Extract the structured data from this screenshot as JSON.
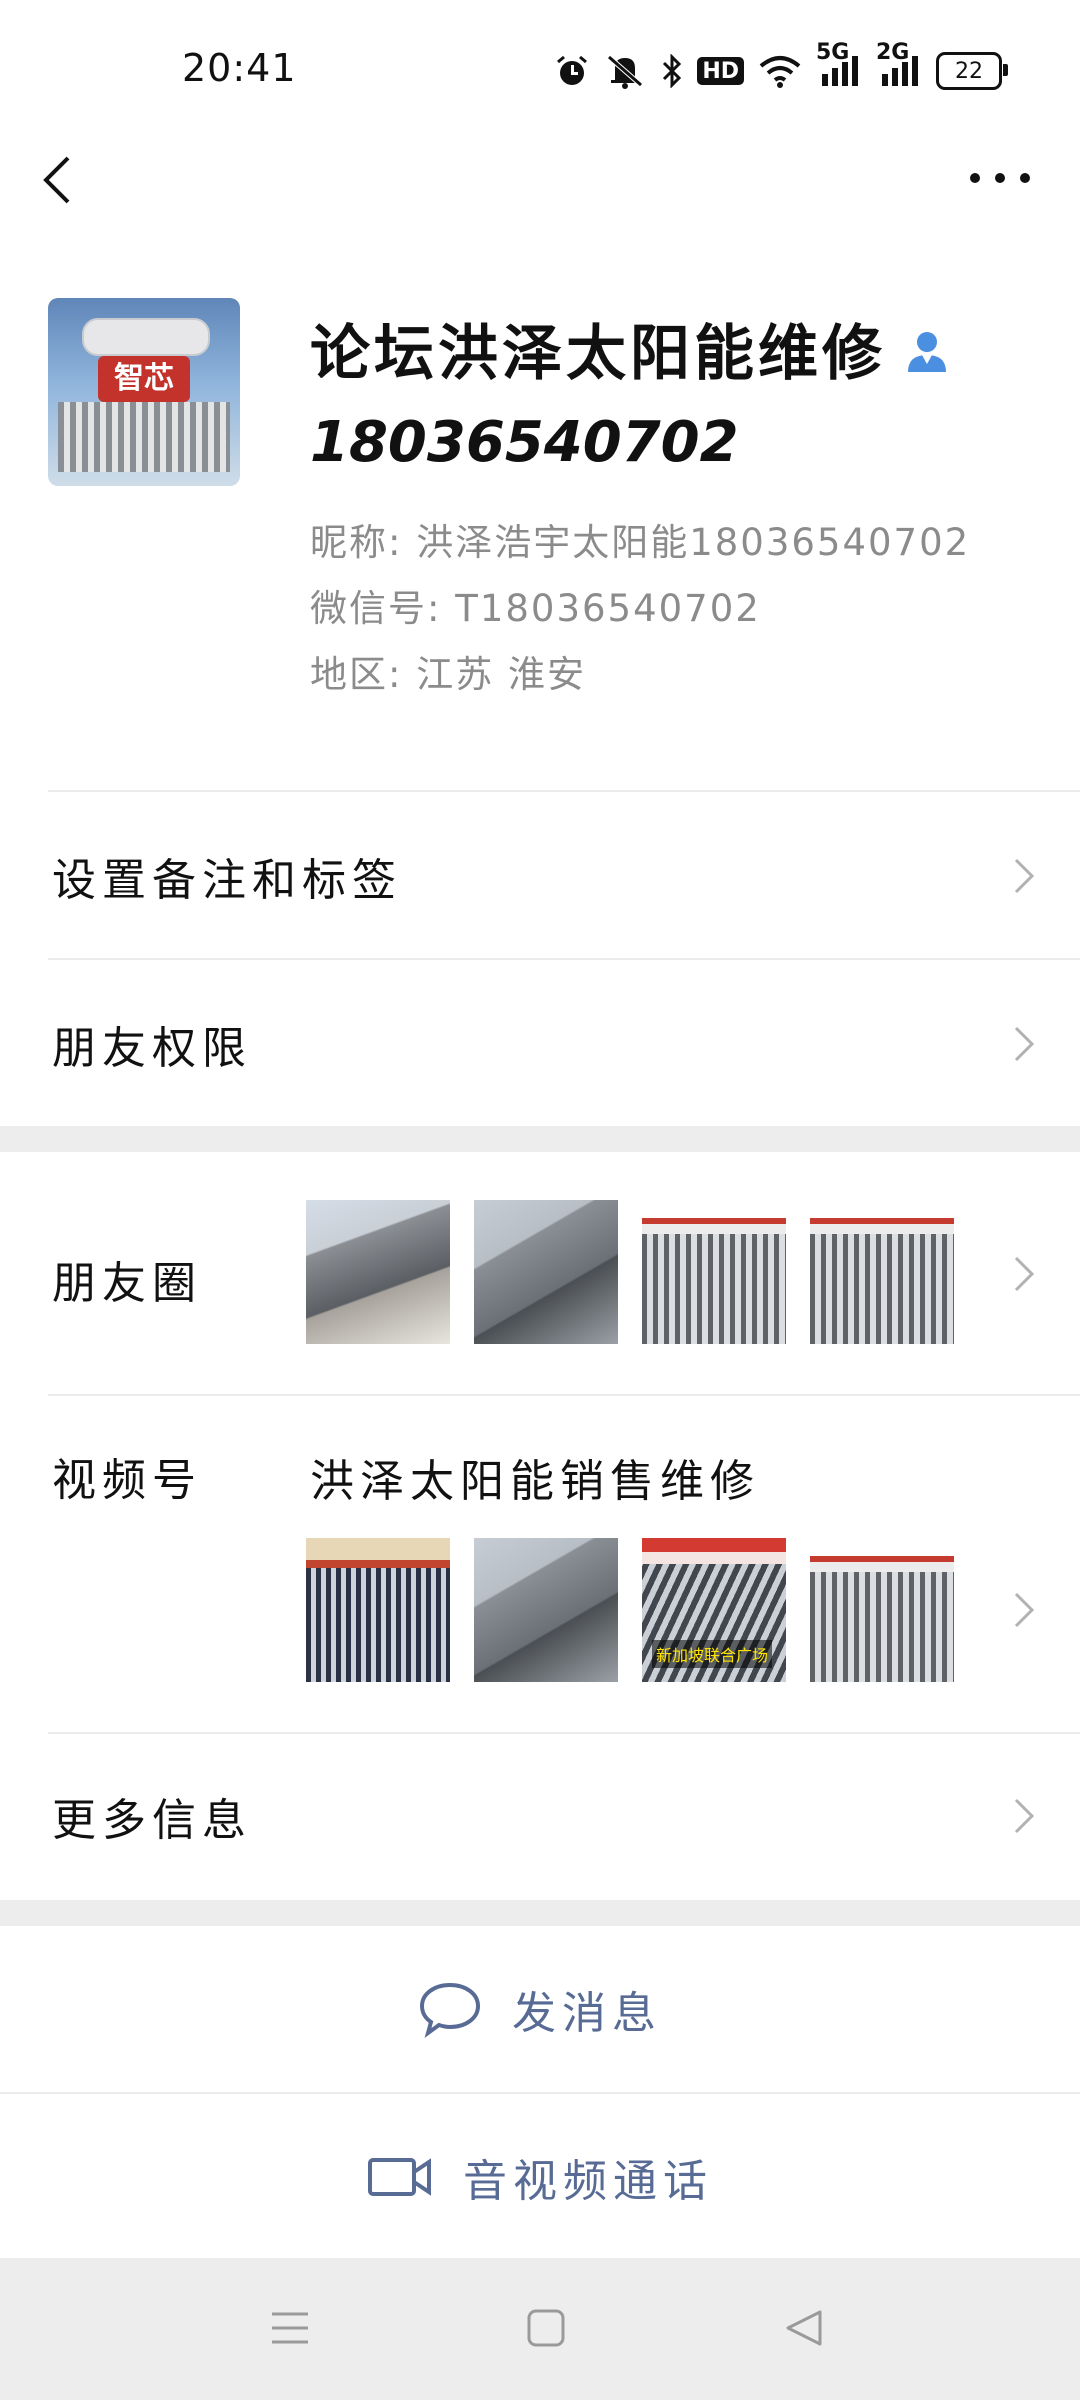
{
  "status_bar": {
    "time": "20:41",
    "icons": [
      "alarm-icon",
      "mute-icon",
      "bluetooth-icon",
      "hd-icon",
      "wifi-icon",
      "signal-5g-icon",
      "signal-2g-icon",
      "battery-icon"
    ],
    "hd": "HD",
    "net1": "5G",
    "net2": "2G",
    "battery": "22"
  },
  "profile": {
    "name": "论坛洪泽太阳能维修",
    "phone": "18036540702",
    "nickname": "昵称: 洪泽浩宇太阳能18036540702",
    "wechat_id": "微信号: T18036540702",
    "region": "地区: 江苏 淮安",
    "avatar_text": "智芯"
  },
  "rows": {
    "set_remark": "设置备注和标签",
    "friend_permission": "朋友权限",
    "moments": "朋友圈",
    "channels": "视频号",
    "channels_name": "洪泽太阳能销售维修",
    "more_info": "更多信息"
  },
  "channels_thumb_caption": "新加坡联合广场",
  "actions": {
    "send_message": "发消息",
    "av_call": "音视频通话"
  },
  "colors": {
    "link_blue": "#576b95",
    "divider": "#ebebeb",
    "gap_gray": "#ededed",
    "verified_blue": "#4b8fe0"
  }
}
